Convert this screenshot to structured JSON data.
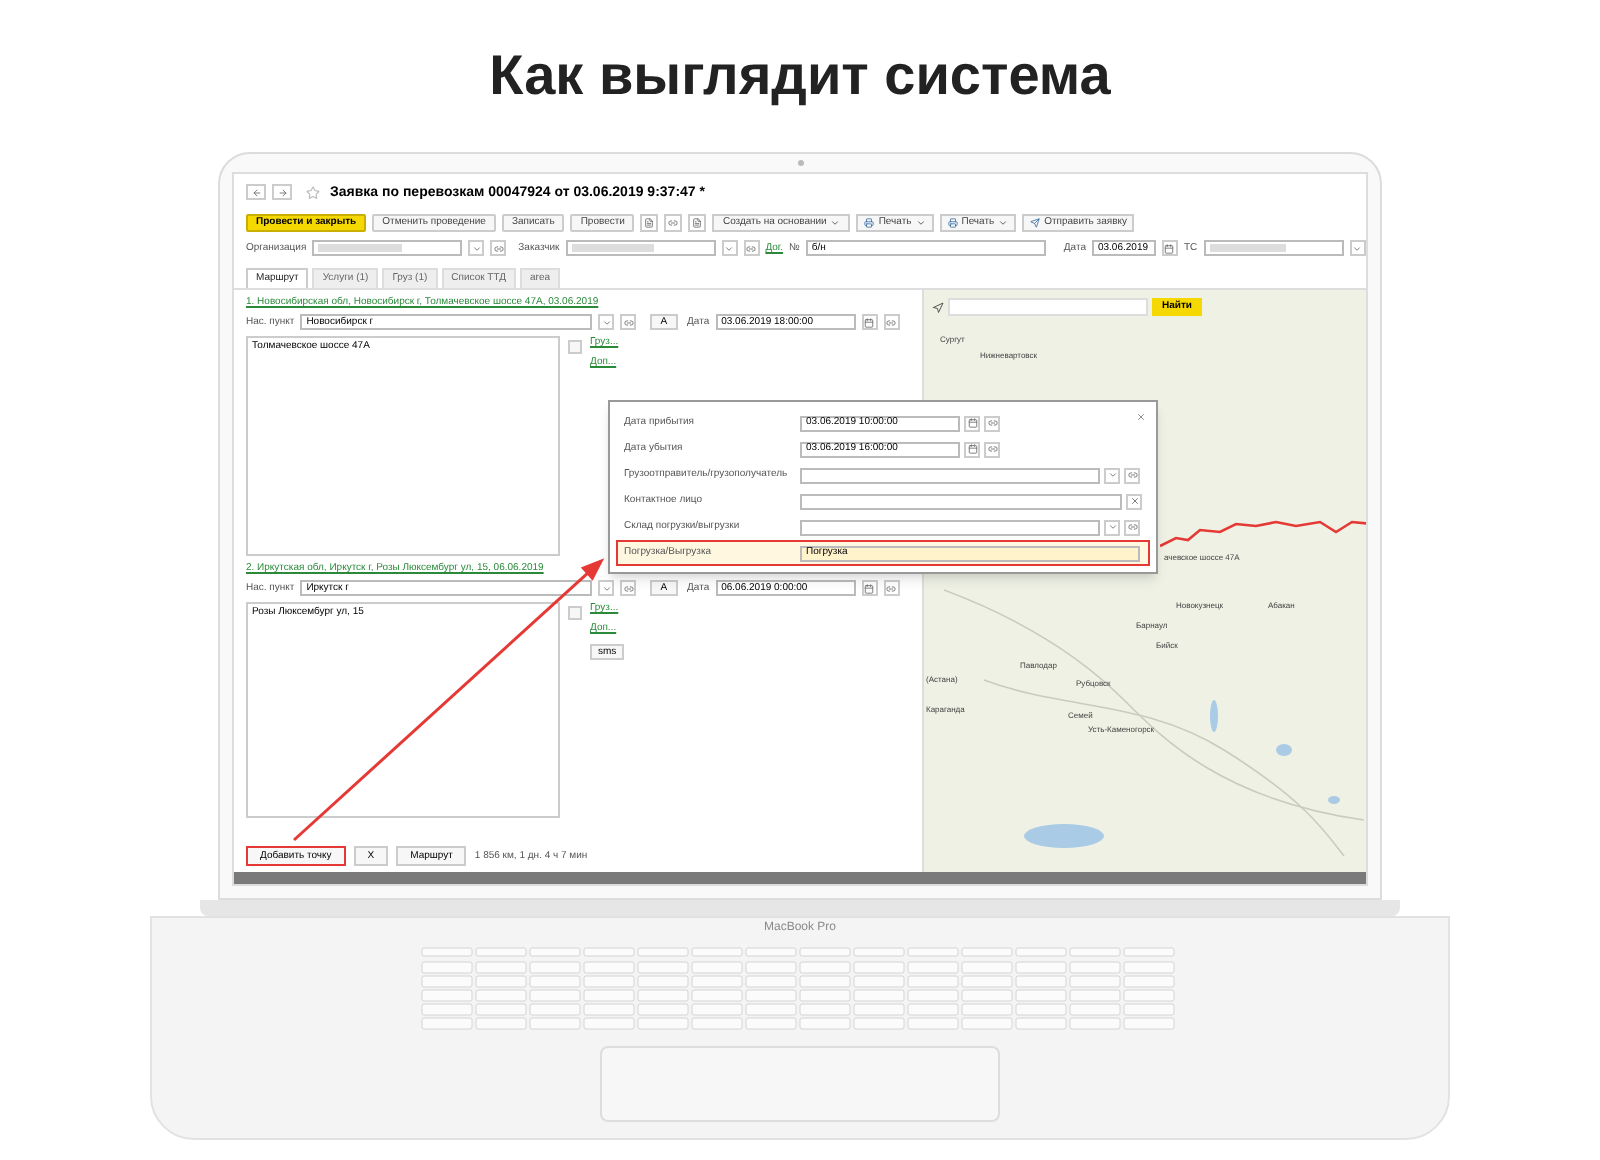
{
  "heading": "Как выглядит система",
  "window": {
    "title": "Заявка по перевозкам 00047924 от 03.06.2019 9:37:47 *"
  },
  "toolbar": [
    {
      "label": "Провести и закрыть",
      "kind": "primary"
    },
    {
      "label": "Отменить проведение",
      "kind": "plain"
    },
    {
      "label": "Записать",
      "kind": "plain"
    },
    {
      "label": "Провести",
      "kind": "plain"
    },
    {
      "kind": "icons"
    },
    {
      "label": "Создать на основании",
      "kind": "dropdown"
    },
    {
      "label": "Печать",
      "kind": "print"
    },
    {
      "label": "Печать",
      "kind": "print"
    },
    {
      "label": "Отправить заявку",
      "kind": "send"
    }
  ],
  "header_fields": {
    "organization_label": "Организация",
    "customer_label": "Заказчик",
    "contract_link": "Дог.",
    "number_label": "№",
    "number": "б/н",
    "date_label": "Дата",
    "date": "03.06.2019",
    "vehicle_label": "ТС"
  },
  "tabs": [
    {
      "label": "Маршрут",
      "selected": true
    },
    {
      "label": "Услуги (1)",
      "selected": false
    },
    {
      "label": "Груз (1)",
      "selected": false
    },
    {
      "label": "Список ТТД",
      "selected": false
    },
    {
      "label": "area",
      "selected": false
    }
  ],
  "points": [
    {
      "header": "1. Новосибирская обл, Новосибирск г, Толмачевское шоссе 47А, 03.06.2019",
      "place_label": "Нас. пункт",
      "place": "Новосибирск г",
      "letter": "А",
      "date_label": "Дата",
      "date": "03.06.2019 18:00:00",
      "address": "Толмачевское шоссе 47А",
      "links": [
        "Груз...",
        "Доп..."
      ]
    },
    {
      "header": "2. Иркутская обл, Иркутск г, Розы Люксембург ул, 15, 06.06.2019",
      "place_label": "Нас. пункт",
      "place": "Иркутск г",
      "letter": "А",
      "date_label": "Дата",
      "date": "06.06.2019 0:00:00",
      "address": "Розы Люксембург ул, 15",
      "links": [
        "Груз...",
        "Доп..."
      ],
      "button": "sms"
    }
  ],
  "popup": {
    "fields": [
      {
        "label": "Дата прибытия",
        "value": "03.06.2019 10:00:00",
        "kind": "date",
        "highlighted": false
      },
      {
        "label": "Дата убытия",
        "value": "03.06.2019 16:00:00",
        "kind": "date",
        "highlighted": false
      },
      {
        "label": "Грузоотправитель/грузополучатель",
        "kind": "select",
        "highlighted": false
      },
      {
        "label": "Контактное лицо",
        "kind": "choice",
        "highlighted": false
      },
      {
        "label": "Склад погрузки/выгрузки",
        "kind": "select",
        "highlighted": false
      },
      {
        "label": "Погрузка/Выгрузка",
        "value": "Погрузка",
        "kind": "text",
        "highlighted": true
      }
    ]
  },
  "bottom": {
    "buttons": [
      {
        "label": "Добавить точку",
        "highlighted": true
      },
      {
        "label": "X",
        "highlighted": false
      },
      {
        "label": "Маршрут",
        "highlighted": false
      }
    ],
    "summary": "1 856 км, 1 дн. 4 ч 7 мин"
  },
  "map": {
    "search_button": "Найти",
    "labels": [
      "Сургут",
      "Нижневартовск",
      "ачевское шоссе 47А",
      "Новокузнецк",
      "Абакан",
      "Барнаул",
      "Бийск",
      "Павлодар",
      "(Астана)",
      "Рубцовск",
      "Караганда",
      "Семей",
      "Усть-Каменогорск"
    ]
  },
  "laptop": {
    "brand": "MacBook Pro"
  }
}
